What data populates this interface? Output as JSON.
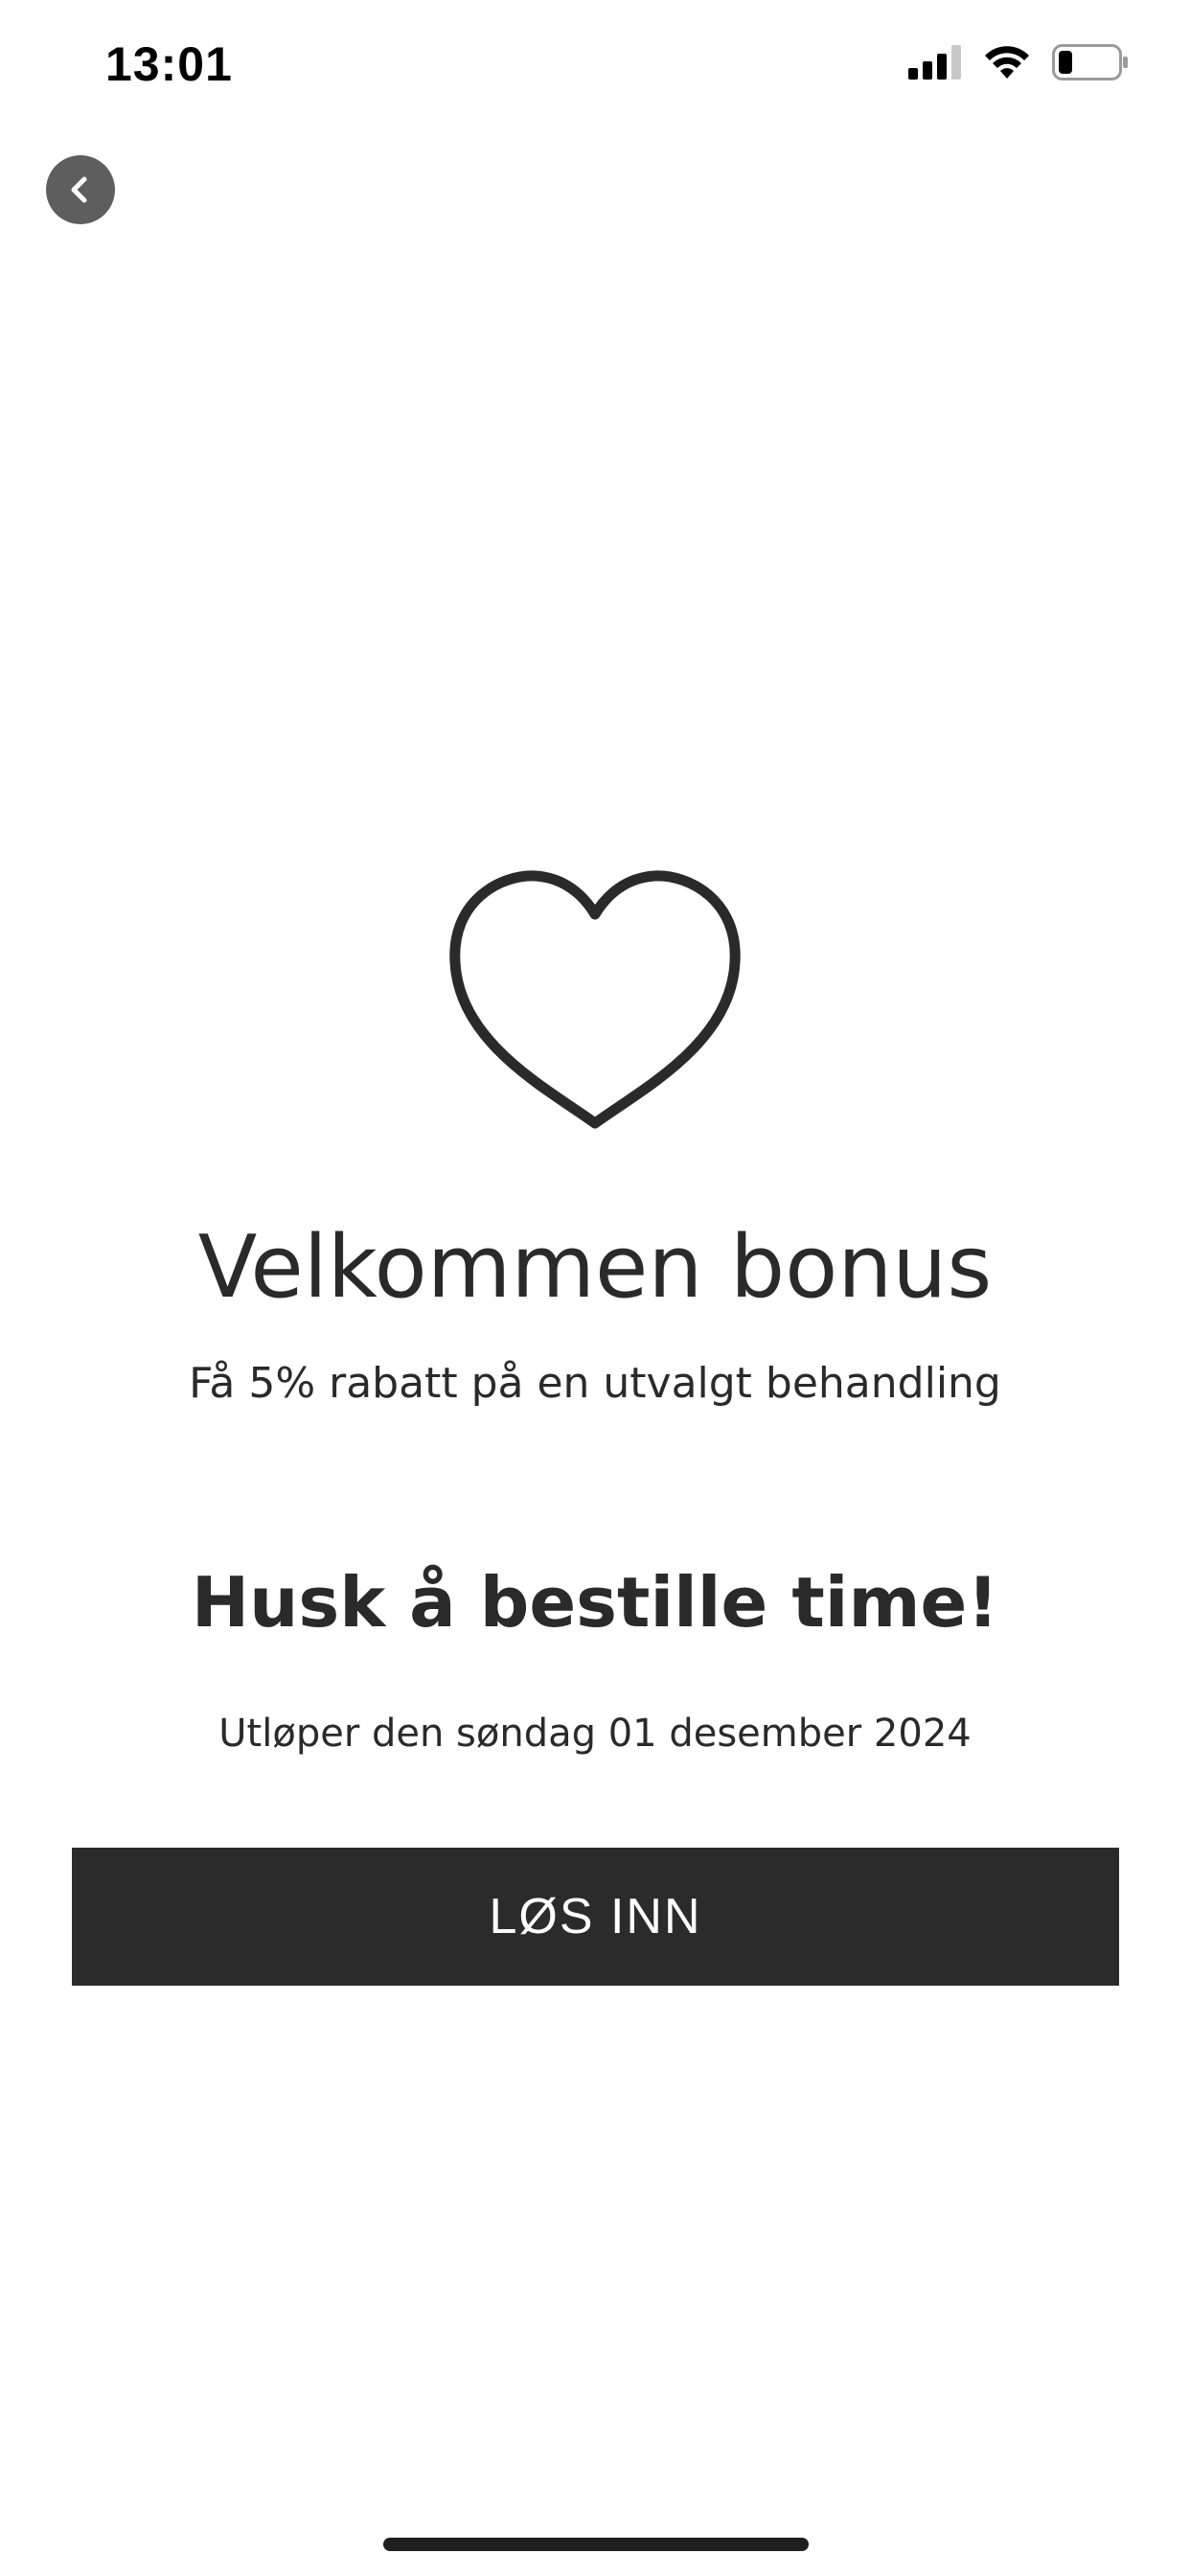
{
  "status_bar": {
    "time": "13:01",
    "icons": [
      "signal-icon",
      "wifi-icon",
      "battery-icon"
    ]
  },
  "nav": {
    "back_icon": "chevron-left-icon"
  },
  "bonus": {
    "icon": "heart-outline-icon",
    "title": "Velkommen bonus",
    "subtitle": "Få 5% rabatt på en utvalgt behandling",
    "reminder": "Husk å bestille time!",
    "expiry": "Utløper den søndag 01 desember 2024",
    "redeem_label": "LØS INN"
  },
  "colors": {
    "text": "#2a2a2a",
    "button_bg": "#2b2b2b",
    "button_text": "#ffffff",
    "back_button_bg": "#5e5e5e"
  }
}
